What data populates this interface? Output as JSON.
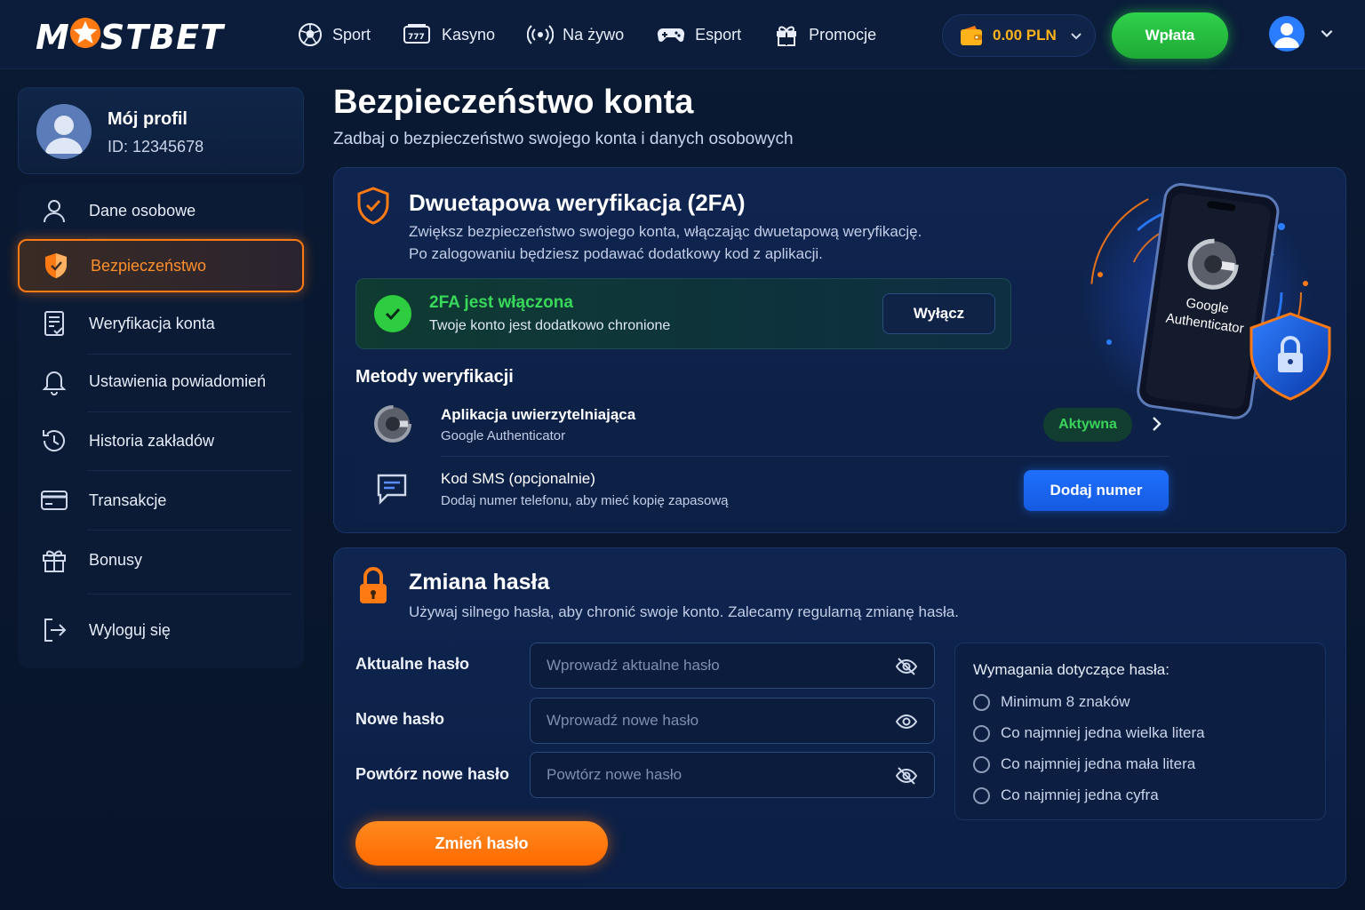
{
  "header": {
    "logo_left": "M",
    "logo_right": "STBET",
    "nav": [
      {
        "label": "Sport",
        "icon": "soccer-ball-icon"
      },
      {
        "label": "Kasyno",
        "icon": "slot-machine-icon"
      },
      {
        "label": "Na żywo",
        "icon": "live-broadcast-icon"
      },
      {
        "label": "Esport",
        "icon": "gamepad-icon"
      },
      {
        "label": "Promocje",
        "icon": "gift-icon"
      }
    ],
    "balance": "0.00 PLN",
    "deposit_label": "Wpłata"
  },
  "sidebar": {
    "profile_name": "Mój profil",
    "profile_id": "ID: 12345678",
    "items": [
      {
        "label": "Dane osobowe",
        "icon": "user-icon"
      },
      {
        "label": "Bezpieczeństwo",
        "icon": "shield-icon",
        "active": true
      },
      {
        "label": "Weryfikacja konta",
        "icon": "document-check-icon"
      },
      {
        "label": "Ustawienia powiadomień",
        "icon": "bell-icon"
      },
      {
        "label": "Historia zakładów",
        "icon": "history-icon"
      },
      {
        "label": "Transakcje",
        "icon": "credit-card-icon"
      },
      {
        "label": "Bonusy",
        "icon": "gift-icon"
      },
      {
        "label": "Wyloguj się",
        "icon": "logout-icon"
      }
    ]
  },
  "main": {
    "title": "Bezpieczeństwo konta",
    "subtitle": "Zadbaj o bezpieczeństwo swojego konta i danych osobowych",
    "twofa": {
      "title": "Dwuetapowa weryfikacja (2FA)",
      "desc_line1": "Zwiększ bezpieczeństwo swojego konta, włączając dwuetapową weryfikację.",
      "desc_line2": "Po zalogowaniu będziesz podawać dodatkowy kod z aplikacji.",
      "status_title": "2FA jest włączona",
      "status_sub": "Twoje konto jest dodatkowo chronione",
      "disable_label": "Wyłącz",
      "methods_title": "Metody weryfikacji",
      "methods": [
        {
          "title": "Aplikacja uwierzytelniająca",
          "sub": "Google Authenticator",
          "badge": "Aktywna"
        },
        {
          "title": "Kod SMS",
          "title_suffix": " (opcjonalnie)",
          "sub": "Dodaj numer telefonu, aby mieć kopię zapasową",
          "button": "Dodaj numer"
        }
      ],
      "illustration_line1": "Google",
      "illustration_line2": "Authenticator"
    },
    "password": {
      "title": "Zmiana hasła",
      "desc": "Używaj silnego hasła, aby chronić swoje konto. Zalecamy regularną zmianę hasła.",
      "fields": [
        {
          "label": "Aktualne hasło",
          "placeholder": "Wprowadź aktualne hasło"
        },
        {
          "label": "Nowe hasło",
          "placeholder": "Wprowadź nowe hasło"
        },
        {
          "label": "Powtórz nowe hasło",
          "placeholder": "Powtórz nowe hasło"
        }
      ],
      "submit_label": "Zmień hasło",
      "requirements_title": "Wymagania dotyczące hasła:",
      "requirements": [
        "Minimum 8 znaków",
        "Co najmniej jedna wielka litera",
        "Co najmniej jedna mała litera",
        "Co najmniej jedna cyfra"
      ]
    }
  },
  "colors": {
    "accent": "#ff7a12",
    "success": "#2ecc40",
    "primary": "#1f6fff",
    "background": "#0a1a33"
  }
}
